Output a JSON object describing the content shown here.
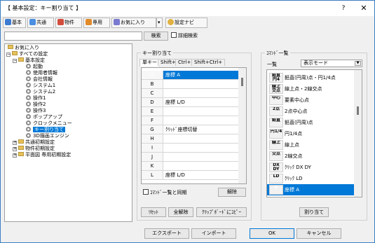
{
  "window": {
    "title": "【 基本設定：キー割り当て 】",
    "help": "?",
    "close": "✕"
  },
  "toolbar": {
    "basic": "基本",
    "common": "共通",
    "property": "物件",
    "dedicated": "専用",
    "favorites": "お気に入り",
    "dropdown": "▾",
    "settings_navi": "設定ナビ"
  },
  "search": {
    "value": "",
    "button": "検索",
    "detail_label": "詳細検索"
  },
  "tree": {
    "items": [
      {
        "label": "お気に入り"
      },
      {
        "label": "すべての設定"
      },
      {
        "label": "基本設定"
      },
      {
        "label": "起動"
      },
      {
        "label": "使用者情報"
      },
      {
        "label": "会社情報"
      },
      {
        "label": "システム1"
      },
      {
        "label": "システム2"
      },
      {
        "label": "操作1"
      },
      {
        "label": "操作2"
      },
      {
        "label": "操作3"
      },
      {
        "label": "ポップアップ"
      },
      {
        "label": "クロックメニュー"
      },
      {
        "label": "キー割り当て"
      },
      {
        "label": "3D描画エンジン"
      },
      {
        "label": "共通初期設定"
      },
      {
        "label": "物件初期設定"
      },
      {
        "label": "平面図 専用初期設定"
      }
    ]
  },
  "key_assign": {
    "group_label": "キー割り当て",
    "tabs": [
      "単キー",
      "Shift+",
      "Ctrl+",
      "Shift+Ctrl+"
    ],
    "rows": [
      {
        "key": "A",
        "value": "座標 A"
      },
      {
        "key": "B",
        "value": ""
      },
      {
        "key": "C",
        "value": ""
      },
      {
        "key": "D",
        "value": "座標 L/D"
      },
      {
        "key": "E",
        "value": ""
      },
      {
        "key": "F",
        "value": ""
      },
      {
        "key": "G",
        "value": "ｸﾘｯﾄﾞ座標切替"
      },
      {
        "key": "H",
        "value": ""
      },
      {
        "key": "I",
        "value": ""
      },
      {
        "key": "J",
        "value": ""
      },
      {
        "key": "K",
        "value": ""
      },
      {
        "key": "L",
        "value": "座標 L/D"
      }
    ],
    "sync_label": "ｺﾏﾝﾄﾞ一覧と同期",
    "clear_button": "解除",
    "reset_button": "ﾘｾｯﾄ",
    "clear_all_button": "全解除",
    "clipboard_button": "ｸﾘｯﾌﾟﾎﾞｰﾄﾞにｺﾋﾟｰ"
  },
  "command_list": {
    "group_label": "ｺﾏﾝﾄﾞ一覧",
    "list_label": "一覧",
    "mode": "表示モード",
    "items": [
      {
        "icon": "鉛直 円4",
        "label": "鉛直(円周)点・円1/4点"
      },
      {
        "icon": "線上 交点",
        "label": "線上点・2線交点"
      },
      {
        "icon": "中心",
        "label": "要素中心点"
      },
      {
        "icon": "2点",
        "label": "2点中心点"
      },
      {
        "icon": "鉛直",
        "label": "鉛直(円周)点"
      },
      {
        "icon": "円1/4",
        "label": "円1/4点"
      },
      {
        "icon": "線上",
        "label": "線上点"
      },
      {
        "icon": "交点",
        "label": "2線交点"
      },
      {
        "icon": "DX DY",
        "label": "ｸﾘｯｸ DX DY"
      },
      {
        "icon": "LD",
        "label": "ｸﾘｯｸ LD"
      },
      {
        "icon": "A",
        "label": "座標 A"
      }
    ],
    "assign_button": "割り当て"
  },
  "footer": {
    "export": "エクスポート",
    "import": "インポート",
    "ok": "OK",
    "cancel": "キャンセル"
  }
}
